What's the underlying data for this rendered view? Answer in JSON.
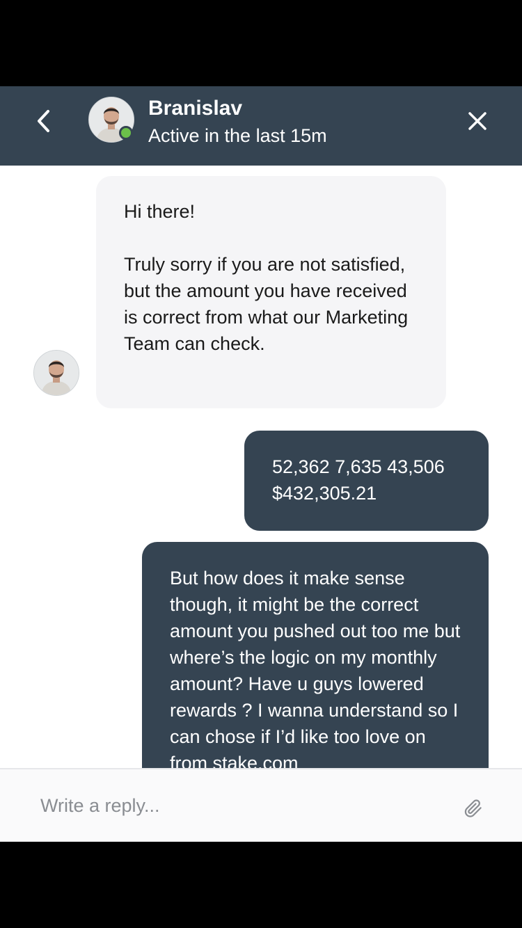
{
  "header": {
    "contact_name": "Branislav",
    "status_text": "Active in the last 15m",
    "back_icon": "chevron-left-icon",
    "close_icon": "close-icon",
    "online": true
  },
  "messages": [
    {
      "from": "agent",
      "text": "Hi there!\n\nTruly sorry if you are not satisfied, but the amount you have received is correct from what our Marketing Team can check."
    },
    {
      "from": "user",
      "text": "52,362 7,635 43,506\n$432,305.21"
    },
    {
      "from": "user",
      "text": "But how does it make sense though, it might be the correct amount you pushed out too me but where’s the logic on my monthly amount? Have u guys lowered rewards ? I wanna understand so I can chose if I’d like too love on from stake.com"
    }
  ],
  "composer": {
    "placeholder": "Write a reply...",
    "value": "",
    "attach_icon": "paperclip-icon"
  },
  "colors": {
    "header_bg": "#354452",
    "user_bubble": "#354452",
    "agent_bubble": "#f5f5f7",
    "online": "#6cc04a"
  }
}
